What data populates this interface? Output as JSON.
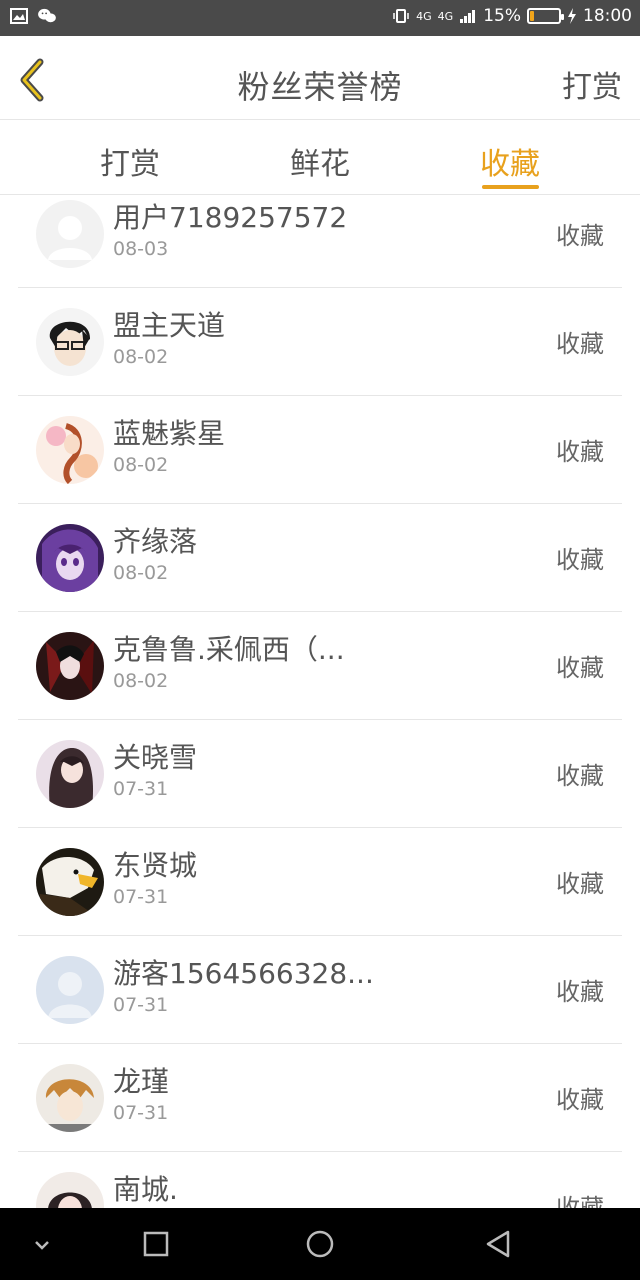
{
  "status_bar": {
    "battery_percent": "15%",
    "time": "18:00",
    "network_1": "4G",
    "network_2": "4G",
    "battery_level": 0.15
  },
  "header": {
    "title": "粉丝荣誉榜",
    "action_label": "打赏"
  },
  "tabs": [
    {
      "label": "打赏",
      "active": false
    },
    {
      "label": "鲜花",
      "active": false
    },
    {
      "label": "收藏",
      "active": true
    }
  ],
  "accent_color": "#e8a11d",
  "list": [
    {
      "name": "用户7189257572",
      "date": "08-03",
      "action": "收藏"
    },
    {
      "name": "盟主天道",
      "date": "08-02",
      "action": "收藏"
    },
    {
      "name": "蓝魅紫星",
      "date": "08-02",
      "action": "收藏"
    },
    {
      "name": "齐缘落",
      "date": "08-02",
      "action": "收藏"
    },
    {
      "name": "克鲁鲁.采佩西（...",
      "date": "08-02",
      "action": "收藏"
    },
    {
      "name": "关晓雪",
      "date": "07-31",
      "action": "收藏"
    },
    {
      "name": "东贤城",
      "date": "07-31",
      "action": "收藏"
    },
    {
      "name": "游客1564566328...",
      "date": "07-31",
      "action": "收藏"
    },
    {
      "name": "龙瑾",
      "date": "07-31",
      "action": "收藏"
    },
    {
      "name": "南城.",
      "date": "",
      "action": "收藏"
    }
  ]
}
